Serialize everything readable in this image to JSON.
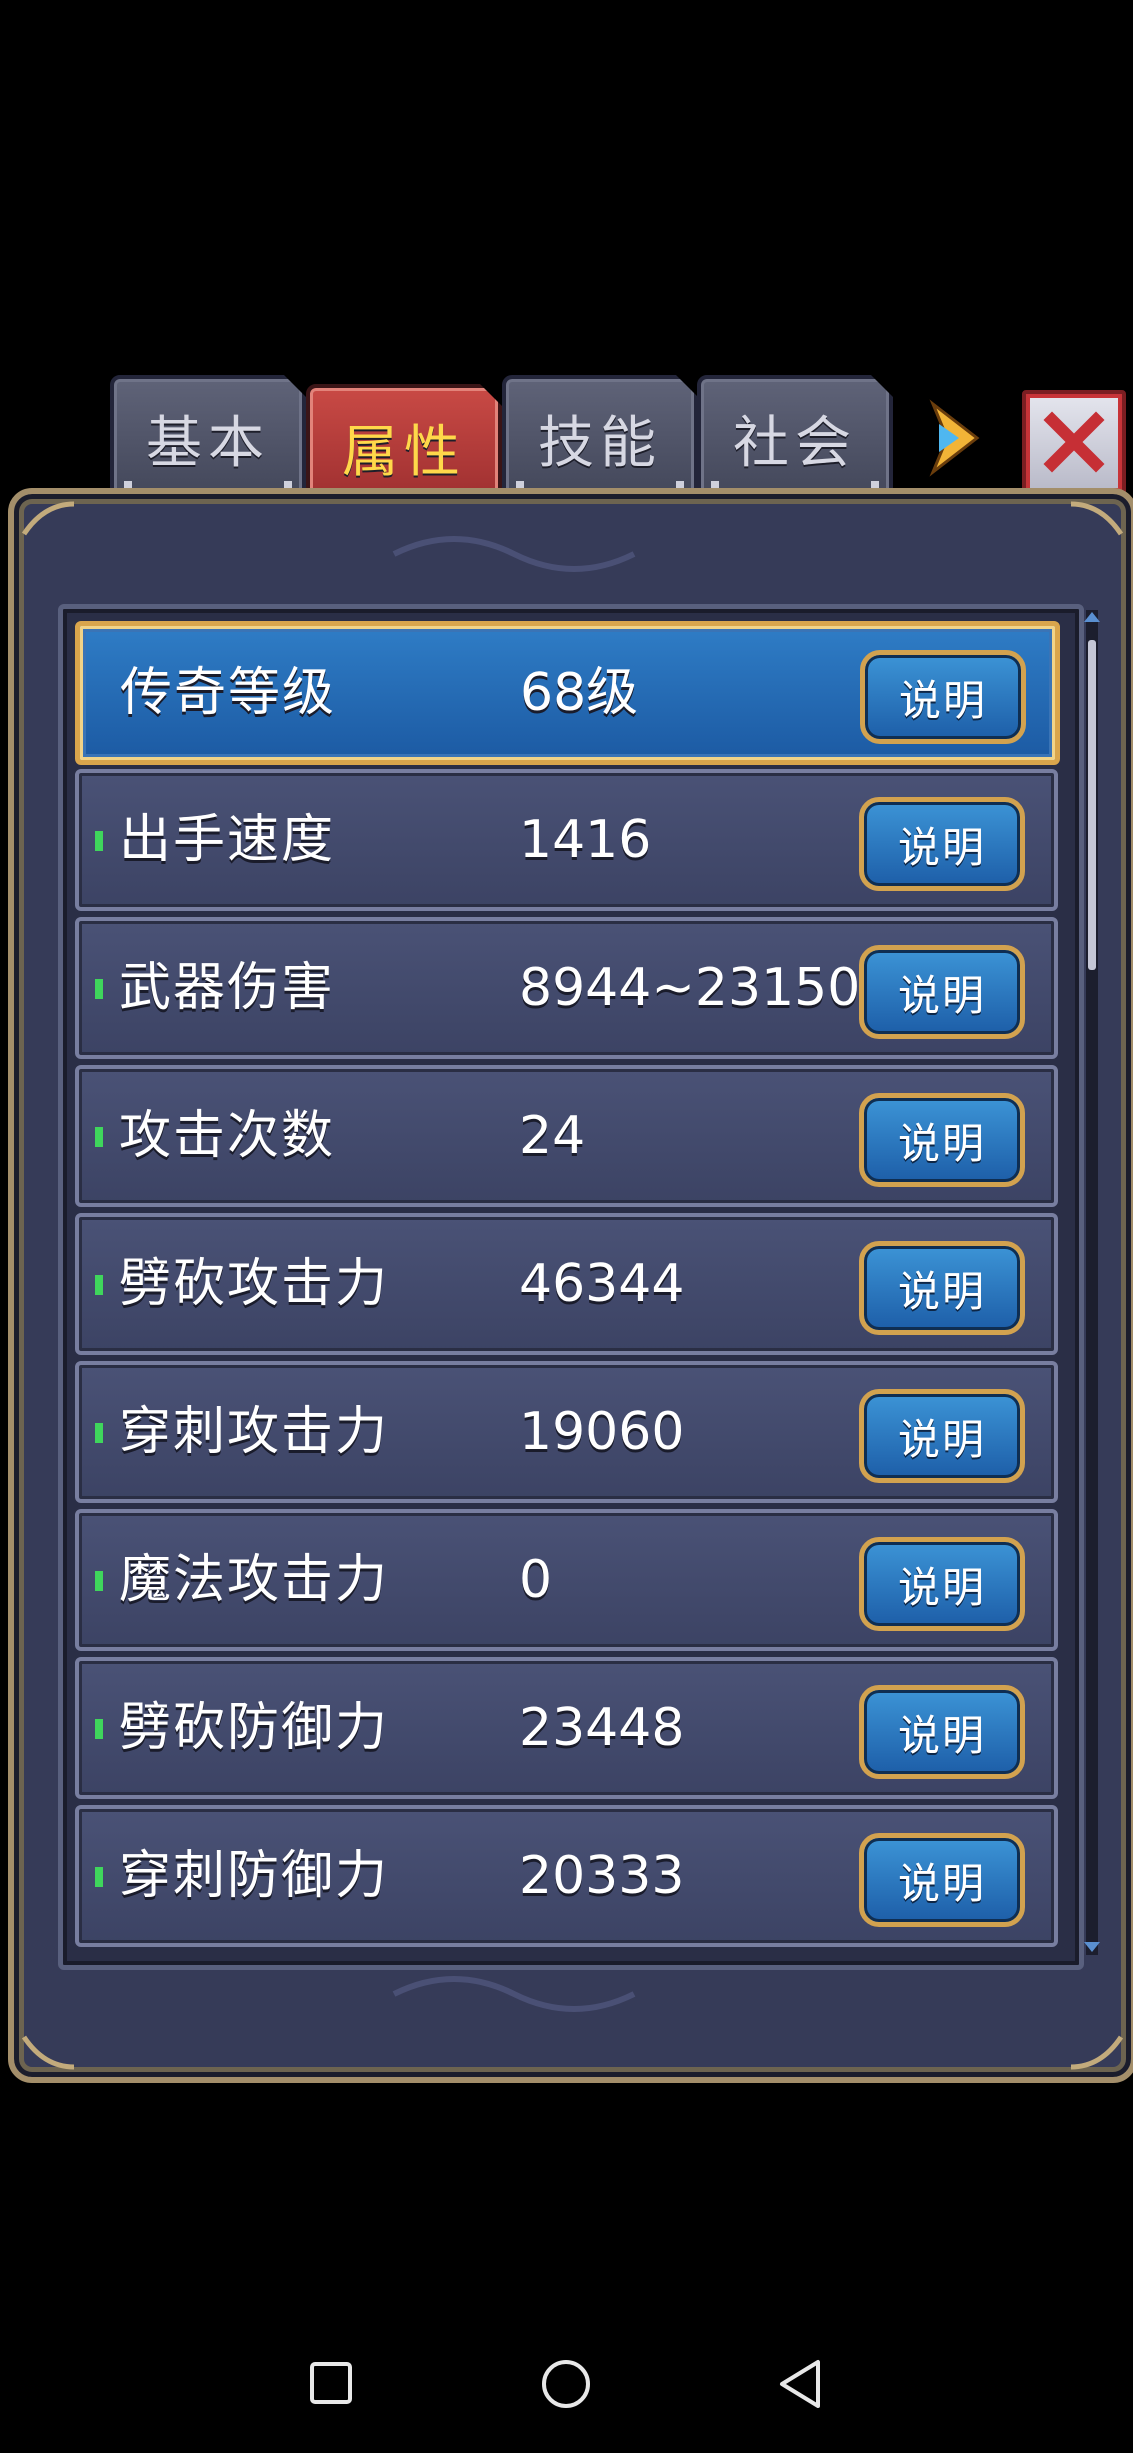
{
  "tabs": [
    {
      "label": "基本",
      "active": false
    },
    {
      "label": "属性",
      "active": true
    },
    {
      "label": "技能",
      "active": false
    },
    {
      "label": "社会",
      "active": false
    }
  ],
  "rows": [
    {
      "label": "传奇等级",
      "value": "68级",
      "button": "说明",
      "highlight": true
    },
    {
      "label": "出手速度",
      "value": "1416",
      "button": "说明"
    },
    {
      "label": "武器伤害",
      "value": "8944~23150",
      "button": "说明"
    },
    {
      "label": "攻击次数",
      "value": "24",
      "button": "说明"
    },
    {
      "label": "劈砍攻击力",
      "value": "46344",
      "button": "说明"
    },
    {
      "label": "穿刺攻击力",
      "value": "19060",
      "button": "说明"
    },
    {
      "label": "魔法攻击力",
      "value": "0",
      "button": "说明"
    },
    {
      "label": "劈砍防御力",
      "value": "23448",
      "button": "说明"
    },
    {
      "label": "穿刺防御力",
      "value": "20333",
      "button": "说明"
    }
  ],
  "colors": {
    "panel": "#363b58",
    "row": "#434a6c",
    "highlight_row": "#2572bd",
    "active_tab": "#b73d3b",
    "gold_border": "#d2a24f"
  },
  "scrollbar": {
    "position_fraction": 0.0,
    "visible_fraction": 0.25
  }
}
